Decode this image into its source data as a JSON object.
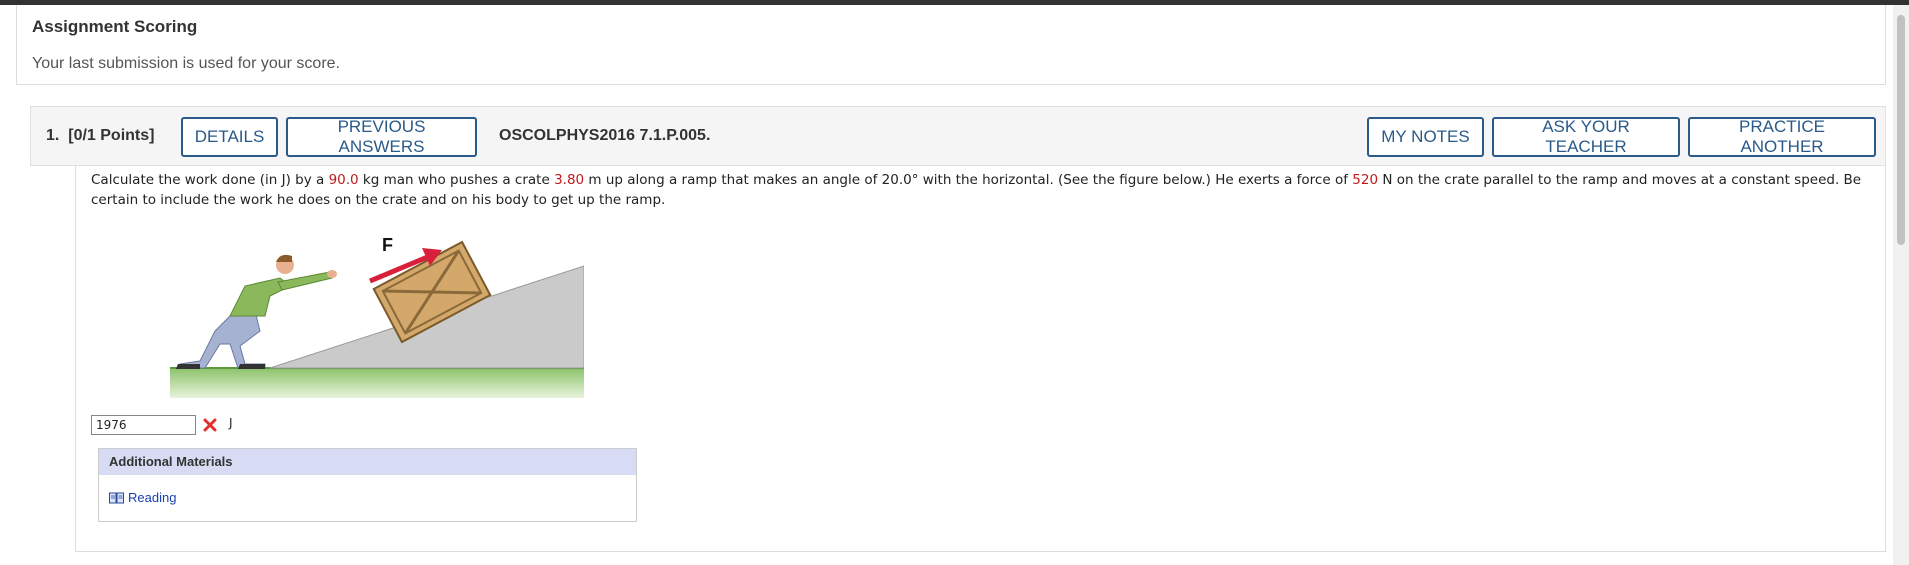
{
  "scoring": {
    "title": "Assignment Scoring",
    "text": "Your last submission is used for your score."
  },
  "question": {
    "number_label": "1.  [0/1 Points]",
    "details_label": "DETAILS",
    "previous_answers_label": "PREVIOUS ANSWERS",
    "code": "OSCOLPHYS2016 7.1.P.005.",
    "my_notes_label": "MY NOTES",
    "ask_teacher_label": "ASK YOUR TEACHER",
    "practice_another_label": "PRACTICE ANOTHER",
    "text": {
      "part1": "Calculate the work done (in J) by a ",
      "mass": "90.0",
      "part2": " kg man who pushes a crate ",
      "distance": "3.80",
      "part3": " m up along a ramp that makes an angle of 20.0° with the horizontal. (See the figure below.) He exerts a force of ",
      "force": "520",
      "part4": " N on the crate parallel to the ramp and moves at a constant speed. Be certain to include the work he does on the crate and on his body to get up the ramp."
    },
    "figure_force_label": "F",
    "answer_value": "1976",
    "answer_status_icon": "incorrect-x-icon",
    "unit": "J"
  },
  "additional_materials": {
    "title": "Additional Materials",
    "link_label": "Reading",
    "link_icon": "book-icon"
  },
  "colors": {
    "accent": "#2a5a8a",
    "highlight_values": "#c21a1a",
    "incorrect": "#e0312f",
    "materials_header": "#d7dbf3"
  }
}
